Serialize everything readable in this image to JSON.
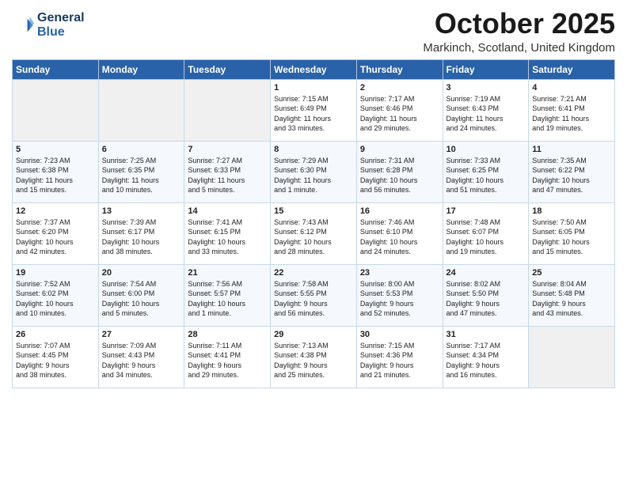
{
  "logo": {
    "line1": "General",
    "line2": "Blue"
  },
  "title": "October 2025",
  "subtitle": "Markinch, Scotland, United Kingdom",
  "days_of_week": [
    "Sunday",
    "Monday",
    "Tuesday",
    "Wednesday",
    "Thursday",
    "Friday",
    "Saturday"
  ],
  "weeks": [
    [
      {
        "day": "",
        "info": ""
      },
      {
        "day": "",
        "info": ""
      },
      {
        "day": "",
        "info": ""
      },
      {
        "day": "1",
        "info": "Sunrise: 7:15 AM\nSunset: 6:49 PM\nDaylight: 11 hours\nand 33 minutes."
      },
      {
        "day": "2",
        "info": "Sunrise: 7:17 AM\nSunset: 6:46 PM\nDaylight: 11 hours\nand 29 minutes."
      },
      {
        "day": "3",
        "info": "Sunrise: 7:19 AM\nSunset: 6:43 PM\nDaylight: 11 hours\nand 24 minutes."
      },
      {
        "day": "4",
        "info": "Sunrise: 7:21 AM\nSunset: 6:41 PM\nDaylight: 11 hours\nand 19 minutes."
      }
    ],
    [
      {
        "day": "5",
        "info": "Sunrise: 7:23 AM\nSunset: 6:38 PM\nDaylight: 11 hours\nand 15 minutes."
      },
      {
        "day": "6",
        "info": "Sunrise: 7:25 AM\nSunset: 6:35 PM\nDaylight: 11 hours\nand 10 minutes."
      },
      {
        "day": "7",
        "info": "Sunrise: 7:27 AM\nSunset: 6:33 PM\nDaylight: 11 hours\nand 5 minutes."
      },
      {
        "day": "8",
        "info": "Sunrise: 7:29 AM\nSunset: 6:30 PM\nDaylight: 11 hours\nand 1 minute."
      },
      {
        "day": "9",
        "info": "Sunrise: 7:31 AM\nSunset: 6:28 PM\nDaylight: 10 hours\nand 56 minutes."
      },
      {
        "day": "10",
        "info": "Sunrise: 7:33 AM\nSunset: 6:25 PM\nDaylight: 10 hours\nand 51 minutes."
      },
      {
        "day": "11",
        "info": "Sunrise: 7:35 AM\nSunset: 6:22 PM\nDaylight: 10 hours\nand 47 minutes."
      }
    ],
    [
      {
        "day": "12",
        "info": "Sunrise: 7:37 AM\nSunset: 6:20 PM\nDaylight: 10 hours\nand 42 minutes."
      },
      {
        "day": "13",
        "info": "Sunrise: 7:39 AM\nSunset: 6:17 PM\nDaylight: 10 hours\nand 38 minutes."
      },
      {
        "day": "14",
        "info": "Sunrise: 7:41 AM\nSunset: 6:15 PM\nDaylight: 10 hours\nand 33 minutes."
      },
      {
        "day": "15",
        "info": "Sunrise: 7:43 AM\nSunset: 6:12 PM\nDaylight: 10 hours\nand 28 minutes."
      },
      {
        "day": "16",
        "info": "Sunrise: 7:46 AM\nSunset: 6:10 PM\nDaylight: 10 hours\nand 24 minutes."
      },
      {
        "day": "17",
        "info": "Sunrise: 7:48 AM\nSunset: 6:07 PM\nDaylight: 10 hours\nand 19 minutes."
      },
      {
        "day": "18",
        "info": "Sunrise: 7:50 AM\nSunset: 6:05 PM\nDaylight: 10 hours\nand 15 minutes."
      }
    ],
    [
      {
        "day": "19",
        "info": "Sunrise: 7:52 AM\nSunset: 6:02 PM\nDaylight: 10 hours\nand 10 minutes."
      },
      {
        "day": "20",
        "info": "Sunrise: 7:54 AM\nSunset: 6:00 PM\nDaylight: 10 hours\nand 5 minutes."
      },
      {
        "day": "21",
        "info": "Sunrise: 7:56 AM\nSunset: 5:57 PM\nDaylight: 10 hours\nand 1 minute."
      },
      {
        "day": "22",
        "info": "Sunrise: 7:58 AM\nSunset: 5:55 PM\nDaylight: 9 hours\nand 56 minutes."
      },
      {
        "day": "23",
        "info": "Sunrise: 8:00 AM\nSunset: 5:53 PM\nDaylight: 9 hours\nand 52 minutes."
      },
      {
        "day": "24",
        "info": "Sunrise: 8:02 AM\nSunset: 5:50 PM\nDaylight: 9 hours\nand 47 minutes."
      },
      {
        "day": "25",
        "info": "Sunrise: 8:04 AM\nSunset: 5:48 PM\nDaylight: 9 hours\nand 43 minutes."
      }
    ],
    [
      {
        "day": "26",
        "info": "Sunrise: 7:07 AM\nSunset: 4:45 PM\nDaylight: 9 hours\nand 38 minutes."
      },
      {
        "day": "27",
        "info": "Sunrise: 7:09 AM\nSunset: 4:43 PM\nDaylight: 9 hours\nand 34 minutes."
      },
      {
        "day": "28",
        "info": "Sunrise: 7:11 AM\nSunset: 4:41 PM\nDaylight: 9 hours\nand 29 minutes."
      },
      {
        "day": "29",
        "info": "Sunrise: 7:13 AM\nSunset: 4:38 PM\nDaylight: 9 hours\nand 25 minutes."
      },
      {
        "day": "30",
        "info": "Sunrise: 7:15 AM\nSunset: 4:36 PM\nDaylight: 9 hours\nand 21 minutes."
      },
      {
        "day": "31",
        "info": "Sunrise: 7:17 AM\nSunset: 4:34 PM\nDaylight: 9 hours\nand 16 minutes."
      },
      {
        "day": "",
        "info": ""
      }
    ]
  ]
}
